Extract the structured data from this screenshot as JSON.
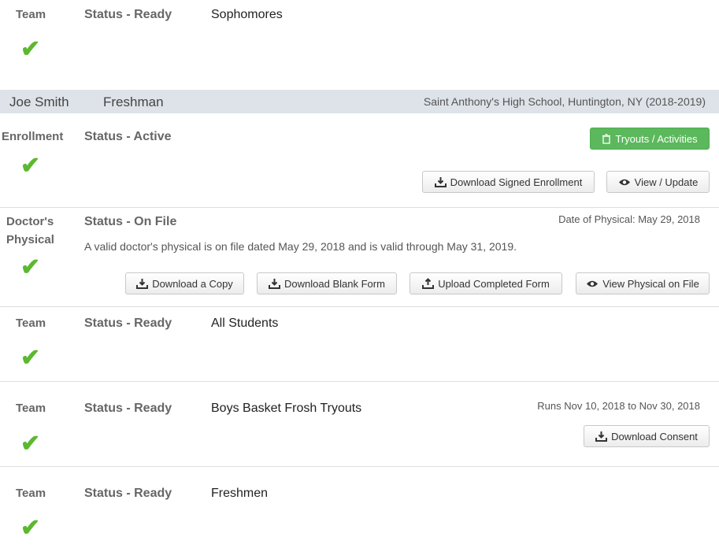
{
  "sections": {
    "team1": {
      "label": "Team",
      "status": "Status - Ready",
      "name": "Sophomores"
    },
    "student": {
      "name": "Joe Smith",
      "grade": "Freshman",
      "school": "Saint Anthony's High School, Huntington, NY (2018-2019)"
    },
    "enrollment": {
      "label": "Enrollment",
      "status": "Status - Active",
      "tryouts_btn": "Tryouts / Activities",
      "download_btn": "Download Signed Enrollment",
      "view_btn": "View / Update"
    },
    "physical": {
      "label_line1": "Doctor's",
      "label_line2": "Physical",
      "status": "Status - On File",
      "date": "Date of Physical: May 29, 2018",
      "description": "A valid doctor's physical is on file dated May 29, 2018 and is valid through May 31, 2019.",
      "btn_copy": "Download a Copy",
      "btn_blank": "Download Blank Form",
      "btn_upload": "Upload Completed Form",
      "btn_view": "View Physical on File"
    },
    "team2": {
      "label": "Team",
      "status": "Status - Ready",
      "name": "All Students"
    },
    "team3": {
      "label": "Team",
      "status": "Status - Ready",
      "name": "Boys Basket Frosh Tryouts",
      "runs": "Runs Nov 10, 2018 to Nov 30, 2018",
      "consent_btn": "Download Consent"
    },
    "team4": {
      "label": "Team",
      "status": "Status - Ready",
      "name": "Freshmen"
    }
  },
  "icons": {
    "check": "checkmark-icon",
    "download": "download-icon",
    "upload": "upload-icon",
    "eye": "eye-icon",
    "trash": "trash-icon"
  },
  "colors": {
    "check": "#5cb82f",
    "primary": "#5cb85c",
    "student_bar": "#dde3e8"
  }
}
